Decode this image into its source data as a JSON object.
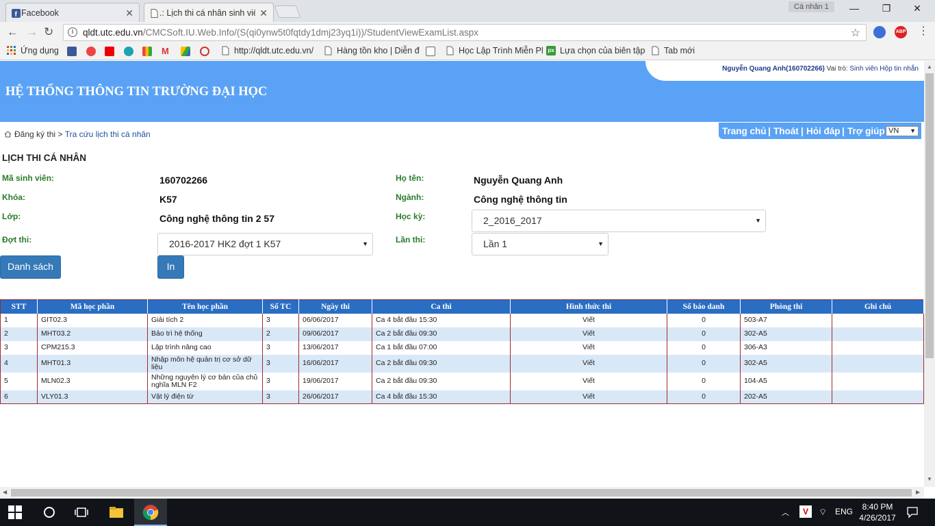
{
  "browser": {
    "tabs": [
      {
        "title": "Facebook",
        "active": false
      },
      {
        "title": ".: Lịch thi cá nhân sinh viê",
        "active": true
      }
    ],
    "profile_label": "Cá nhân 1",
    "url_host": "qldt.utc.edu.vn",
    "url_path": "/CMCSoft.IU.Web.Info/(S(qi0ynw5t0fqtdy1dmj23yq1i))/StudentViewExamList.aspx",
    "bookmarks": {
      "apps": "Ứng dụng",
      "b1": "http://qldt.utc.edu.vn/",
      "b2": "Hàng tồn kho | Diễn đ",
      "b3": "Học Lập Trình Miễn Pl",
      "b4": "Lựa chọn của biên tập",
      "b5": "Tab mới"
    }
  },
  "header": {
    "title": "HỆ THỐNG THÔNG TIN TRƯỜNG ĐẠI HỌC",
    "user_name": "Nguyễn Quang Anh(160702266)",
    "role_label": "Vai trò:",
    "role_value": "Sinh viên",
    "inbox": "Hộp tin nhắn"
  },
  "breadcrumb": {
    "parent": "Đăng ký thi",
    "separator": ">",
    "current": "Tra cứu lịch thi cá nhân"
  },
  "topmenu": {
    "home": "Trang chủ",
    "logout": "Thoát",
    "faq": "Hỏi đáp",
    "help": "Trợ giúp",
    "sep": "|",
    "lang": "VN"
  },
  "section_title": "LỊCH THI CÁ NHÂN",
  "student": {
    "id_label": "Mã sinh viên:",
    "id_value": "160702266",
    "name_label": "Họ tên:",
    "name_value": "Nguyễn Quang Anh",
    "course_label": "Khóa:",
    "course_value": "K57",
    "major_label": "Ngành:",
    "major_value": "Công nghệ thông tin",
    "class_label": "Lớp:",
    "class_value": "Công nghệ thông tin 2 57",
    "term_label": "Học kỳ:",
    "term_value": "2_2016_2017",
    "exam_round_label": "Đợt thi:",
    "exam_round_value": "2016-2017 HK2 đợt 1 K57",
    "attempt_label": "Lần thi:",
    "attempt_value": "Lần 1"
  },
  "buttons": {
    "list": "Danh sách",
    "print": "In"
  },
  "table": {
    "headers": [
      "STT",
      "Mã học phần",
      "Tên học phần",
      "Số TC",
      "Ngày thi",
      "Ca thi",
      "Hình thức thi",
      "Số báo danh",
      "Phòng thi",
      "Ghi chú"
    ],
    "rows": [
      [
        "1",
        "GIT02.3",
        "Giải tích 2",
        "3",
        "06/06/2017",
        "Ca 4 bắt đầu 15:30",
        "Viết",
        "0",
        "503-A7",
        ""
      ],
      [
        "2",
        "MHT03.2",
        "Bảo trì hệ thống",
        "2",
        "09/06/2017",
        "Ca 2 bắt đầu 09:30",
        "Viết",
        "0",
        "302-A5",
        ""
      ],
      [
        "3",
        "CPM215.3",
        "Lập trình nâng cao",
        "3",
        "13/06/2017",
        "Ca 1 bắt đầu 07:00",
        "Viết",
        "0",
        "306-A3",
        ""
      ],
      [
        "4",
        "MHT01.3",
        "Nhập môn hệ quản trị cơ sở dữ liệu",
        "3",
        "16/06/2017",
        "Ca 2 bắt đầu 09:30",
        "Viết",
        "0",
        "302-A5",
        ""
      ],
      [
        "5",
        "MLN02.3",
        "Những nguyên lý cơ bản của chủ nghĩa MLN F2",
        "3",
        "19/06/2017",
        "Ca 2 bắt đầu 09:30",
        "Viết",
        "0",
        "104-A5",
        ""
      ],
      [
        "6",
        "VLY01.3",
        "Vật lý điện từ",
        "3",
        "26/06/2017",
        "Ca 4 bắt đầu 15:30",
        "Viết",
        "0",
        "202-A5",
        ""
      ]
    ]
  },
  "taskbar": {
    "lang": "ENG",
    "time": "8:40 PM",
    "date": "4/26/2017"
  },
  "colors": {
    "banner": "#5aa2f5",
    "table_header": "#2a6ec4",
    "button": "#3579b8",
    "label_green": "#2a7a2a"
  }
}
